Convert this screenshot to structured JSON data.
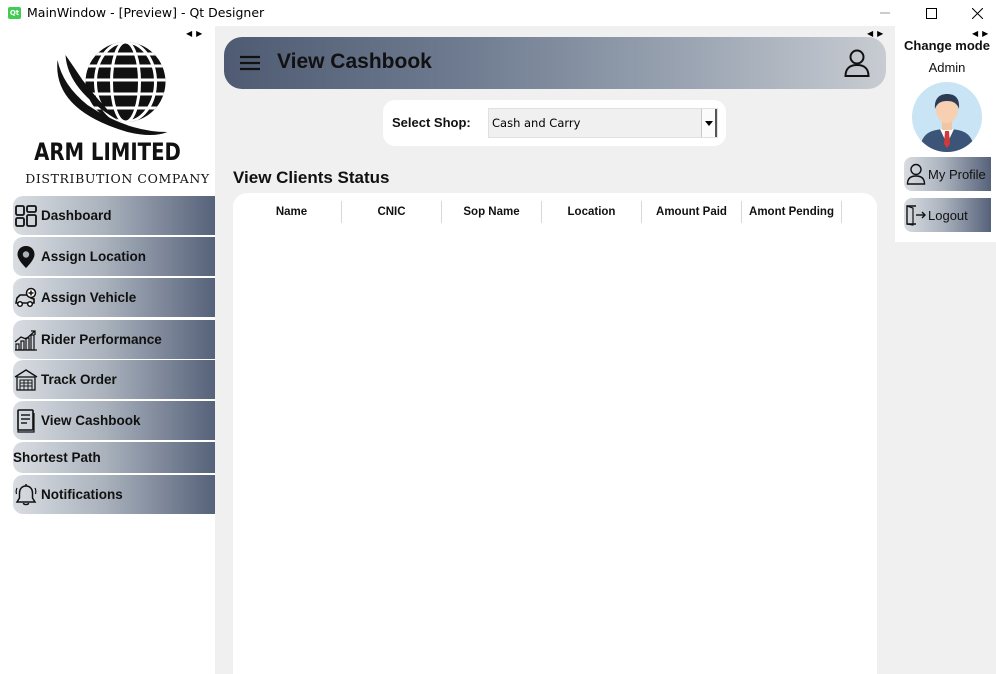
{
  "window": {
    "app_icon_text": "Qt",
    "title": "MainWindow - [Preview] - Qt Designer"
  },
  "logo": {
    "company": "ARM LIMITED",
    "tagline": "DISTRIBUTION COMPANY"
  },
  "sidebar": {
    "items": [
      {
        "label": "Dashboard",
        "icon": "dashboard-grid-icon"
      },
      {
        "label": "Assign Location",
        "icon": "map-pin-icon"
      },
      {
        "label": "Assign Vehicle",
        "icon": "vehicle-icon"
      },
      {
        "label": "Rider Performance",
        "icon": "growth-chart-icon"
      },
      {
        "label": "Track Order",
        "icon": "warehouse-icon"
      },
      {
        "label": "View Cashbook",
        "icon": "cashbook-icon"
      },
      {
        "label": "Shortest Path",
        "icon": ""
      },
      {
        "label": "Notifications",
        "icon": "bell-icon"
      }
    ]
  },
  "header": {
    "title": "View Cashbook"
  },
  "shop": {
    "label": "Select Shop:",
    "selected": "Cash and Carry"
  },
  "section": {
    "title": "View Clients Status"
  },
  "table": {
    "columns": [
      "Name",
      "CNIC",
      "Sop Name",
      "Location",
      "Amount Paid",
      "Amont Pending"
    ],
    "rows": []
  },
  "rightpanel": {
    "change_mode": "Change mode",
    "role": "Admin",
    "buttons": [
      {
        "label": "My Profile",
        "icon": "person-icon"
      },
      {
        "label": "Logout",
        "icon": "logout-icon"
      }
    ]
  },
  "colors": {
    "header_gradient_start": "#4e5b72",
    "header_gradient_end": "#c8ccd2",
    "nav_gradient_end": "#56627a",
    "qt_green": "#41cd52"
  }
}
